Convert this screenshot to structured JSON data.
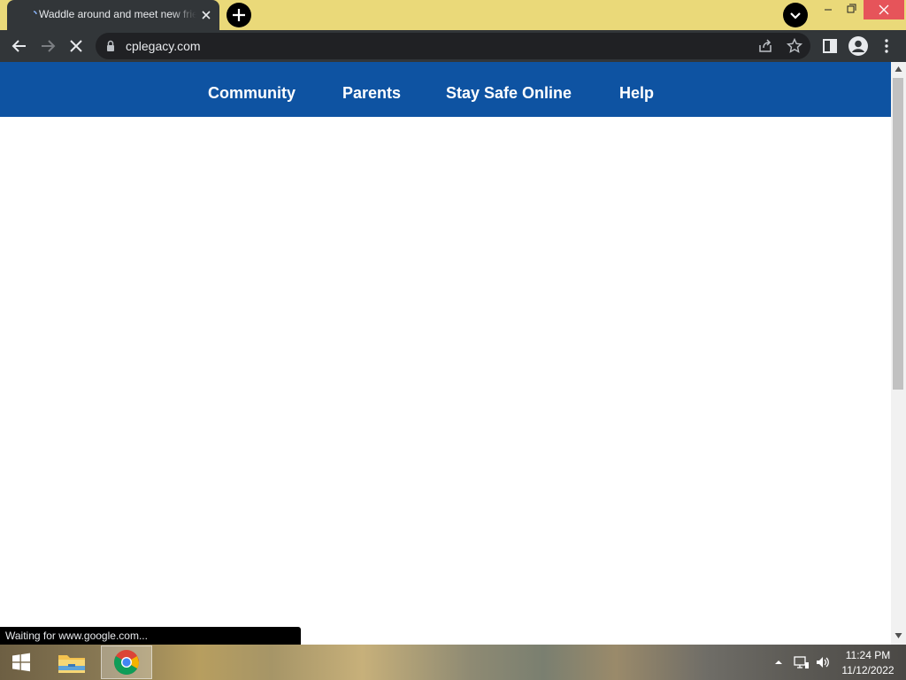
{
  "browser": {
    "tab": {
      "title": "Waddle around and meet new friends",
      "favicon": "loading-spinner-icon",
      "close_icon": "close-icon"
    },
    "new_tab_icon": "plus-icon",
    "tab_search_icon": "chevron-down-icon",
    "window_controls": [
      "minimize-icon",
      "restore-icon",
      "close-icon"
    ],
    "toolbar": {
      "back_icon": "arrow-left-icon",
      "forward_icon": "arrow-right-icon",
      "stop_icon": "close-icon",
      "url": "cplegacy.com",
      "lock_icon": "lock-icon",
      "share_icon": "share-icon",
      "bookmark_icon": "star-icon",
      "side_panel_icon": "side-panel-icon",
      "profile_icon": "avatar-icon",
      "menu_icon": "kebab-menu-icon"
    },
    "status_text": "Waiting for www.google.com..."
  },
  "page": {
    "nav": {
      "items": [
        "Community",
        "Parents",
        "Stay Safe Online",
        "Help"
      ]
    }
  },
  "taskbar": {
    "start_icon": "windows-logo-icon",
    "apps": [
      "file-explorer-icon",
      "chrome-icon"
    ],
    "tray": {
      "icons": [
        "chevron-up-icon",
        "network-icon",
        "volume-icon"
      ],
      "time": "11:24 PM",
      "date": "11/12/2022"
    }
  },
  "colors": {
    "titlebar": "#ead979",
    "toolbar": "#323639",
    "omnibox": "#202124",
    "site_nav": "#0e53a2",
    "window_close": "#e6545a",
    "status_bubble": "#000000"
  }
}
